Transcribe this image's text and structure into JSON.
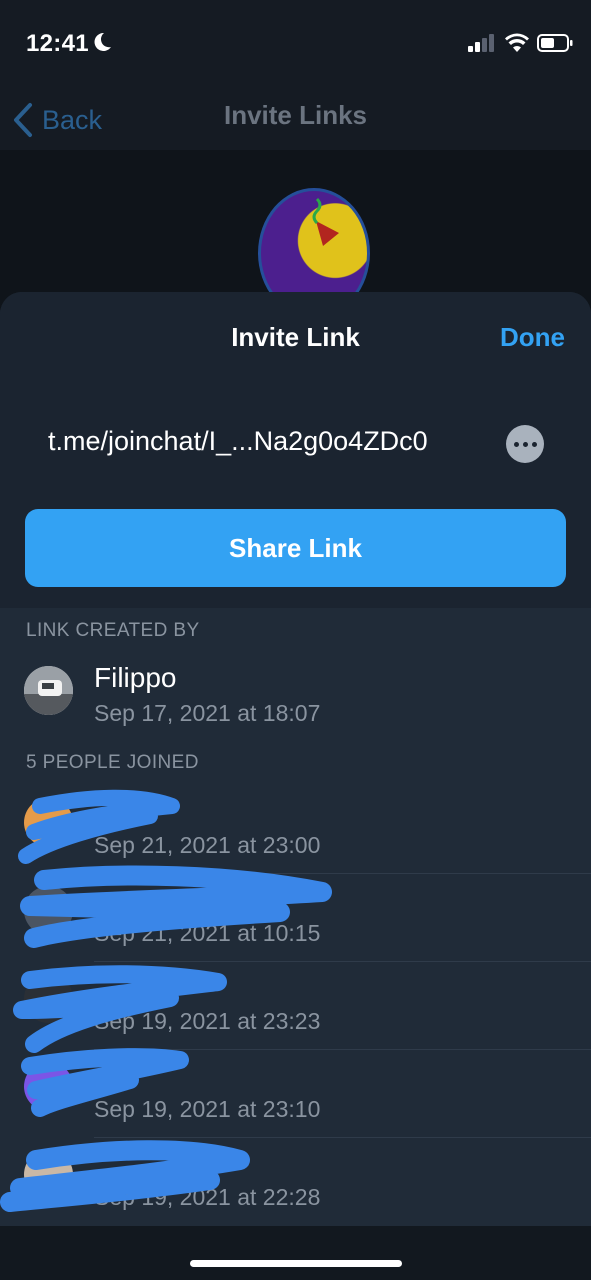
{
  "status_bar": {
    "time": "12:41",
    "icons": [
      "moon-icon",
      "cellular-signal-icon",
      "wifi-icon",
      "battery-icon"
    ]
  },
  "nav": {
    "back_label": "Back",
    "title": "Invite Links"
  },
  "sheet": {
    "title": "Invite Link",
    "done_label": "Done",
    "link": "t.me/joinchat/I_...Na2g0o4ZDc0",
    "share_label": "Share Link"
  },
  "created_by": {
    "section_label": "LINK CREATED BY",
    "name": "Filippo",
    "date": "Sep 17, 2021 at 18:07"
  },
  "joined": {
    "section_label": "5 PEOPLE JOINED",
    "people": [
      {
        "date": "Sep 21, 2021 at 23:00"
      },
      {
        "date": "Sep 21, 2021 at 10:15"
      },
      {
        "date": "Sep 19, 2021 at 23:23"
      },
      {
        "date": "Sep 19, 2021 at 23:10"
      },
      {
        "date": "Sep 19, 2021 at 22:28"
      }
    ]
  },
  "colors": {
    "accent": "#33a2f3",
    "sheet_bg": "#202b38",
    "header_bg": "#1b2430",
    "secondary_text": "#8a94a0",
    "redaction": "#3a86e8"
  }
}
